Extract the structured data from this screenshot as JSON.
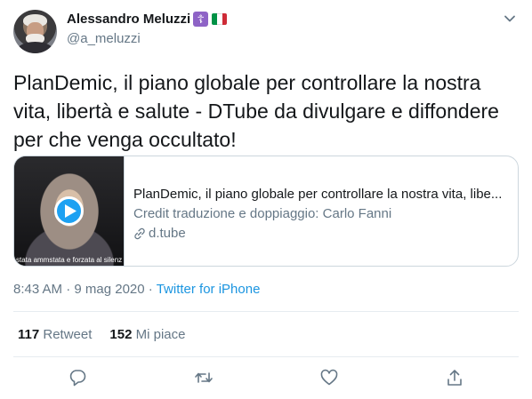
{
  "author": {
    "display_name": "Alessandro Meluzzi",
    "cross_badge": "☦",
    "handle": "@a_meluzzi"
  },
  "tweet": {
    "text": "PlanDemic, il piano globale per controllare la nostra vita, libertà e salute - DTube da divulgare e diffondere per che venga occultato!"
  },
  "card": {
    "media_caption": "stata ammstata e forzata al silenz",
    "title": "PlanDemic, il piano globale per controllare la nostra vita, libe...",
    "description": "Credit traduzione e doppiaggio: Carlo Fanni",
    "domain": "d.tube"
  },
  "meta": {
    "time": "8:43 AM",
    "separator": " · ",
    "date": "9 mag 2020",
    "source": "Twitter for iPhone"
  },
  "stats": {
    "retweets_count": "117",
    "retweets_label": "Retweet",
    "likes_count": "152",
    "likes_label": "Mi piace"
  },
  "colors": {
    "accent": "#1da1f2",
    "secondary_text": "#657786",
    "flag_green": "#009246",
    "flag_white": "#ffffff",
    "flag_red": "#ce2b37"
  },
  "icons": [
    "chevron-down-icon",
    "play-icon",
    "link-icon",
    "reply-icon",
    "retweet-icon",
    "like-icon",
    "share-icon"
  ]
}
